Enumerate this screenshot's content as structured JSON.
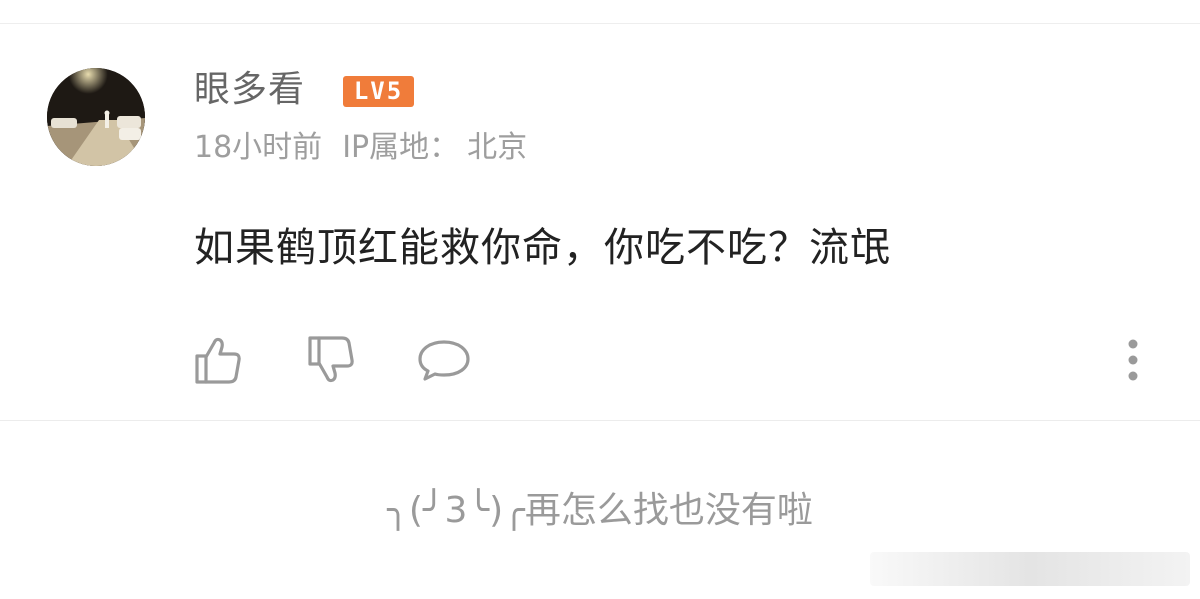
{
  "comment": {
    "username": "眼多看",
    "level_badge": "LV5",
    "time": "18小时前",
    "ip_label": "IP属地：",
    "ip_location": "北京",
    "text": "如果鹤顶红能救你命，你吃不吃？流氓",
    "actions": {
      "like": "thumbs-up-icon",
      "dislike": "thumbs-down-icon",
      "reply": "comment-bubble-icon",
      "more": "more-vertical-icon"
    },
    "colors": {
      "badge": "#f07c3a",
      "username": "#666666",
      "meta": "#9e9e9e",
      "text": "#222222"
    }
  },
  "footer": {
    "end_text": "╮(╯3╰)╭再怎么找也没有啦"
  }
}
